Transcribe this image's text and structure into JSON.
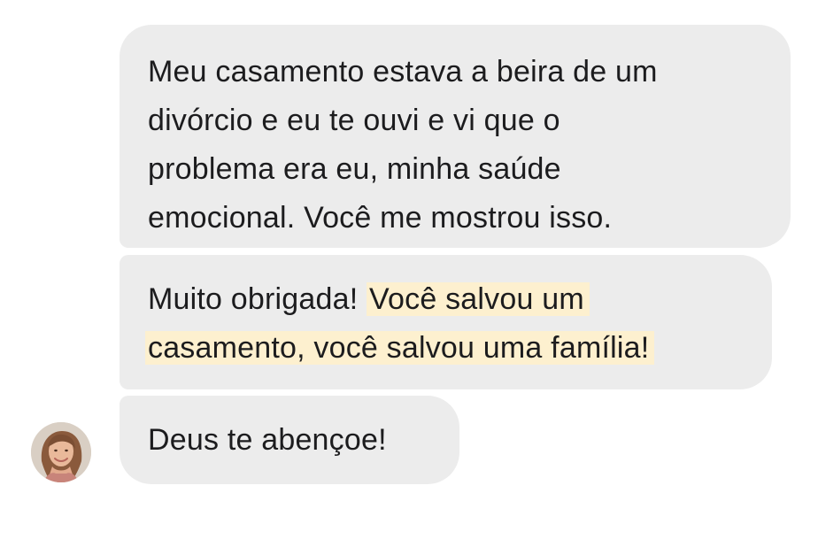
{
  "messages": [
    {
      "lines": [
        "Meu casamento estava a beira de um",
        "divórcio e eu te ouvi e vi que o",
        "problema era eu, minha saúde",
        "emocional. Você me mostrou isso."
      ]
    },
    {
      "line1_plain": "Muito obrigada! ",
      "line1_highlight": "Você salvou um",
      "line2_highlight": "casamento, você salvou uma família!"
    },
    {
      "text": "Deus te abençoe!"
    }
  ],
  "colors": {
    "bubble_background": "#ececec",
    "highlight": "#fdf0cf",
    "text": "#1c1c1e"
  },
  "avatar": {
    "icon": "profile-photo-icon"
  }
}
